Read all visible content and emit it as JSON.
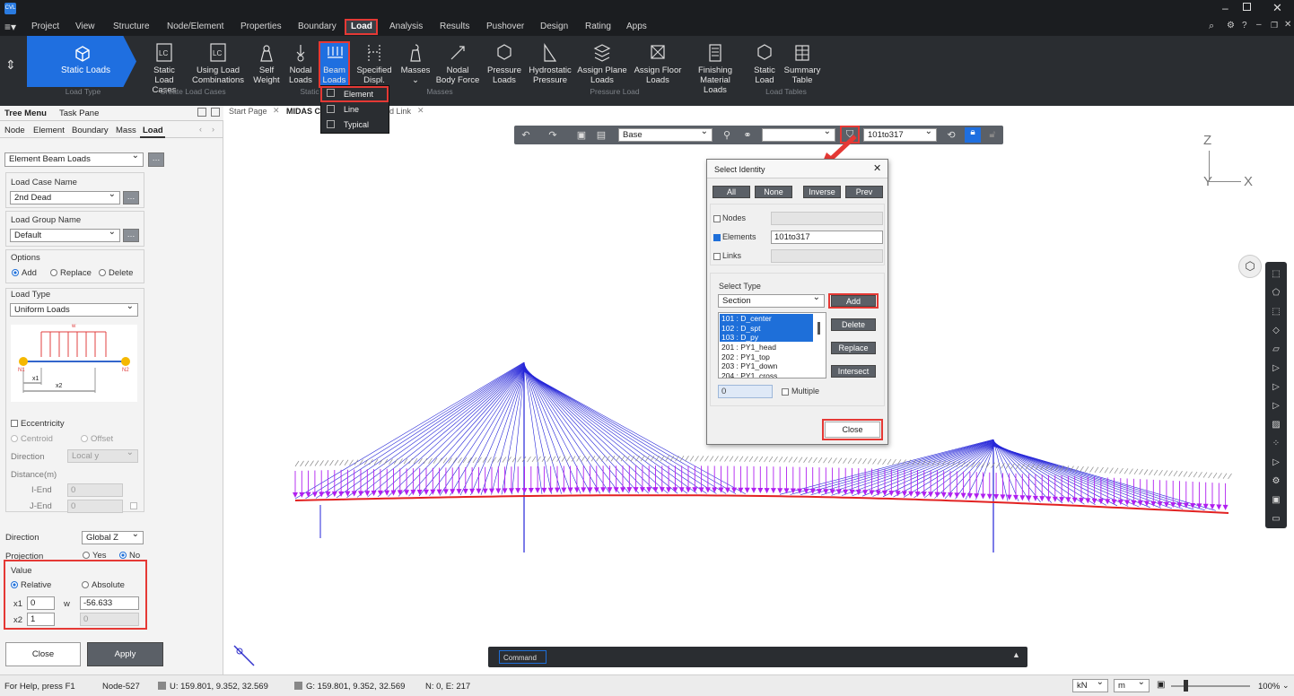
{
  "menu": [
    "Project",
    "View",
    "Structure",
    "Node/Element",
    "Properties",
    "Boundary",
    "Load",
    "Analysis",
    "Results",
    "Pushover",
    "Design",
    "Rating",
    "Apps"
  ],
  "ribbon": {
    "static_loads": "Static Loads",
    "load_type_group": "Load Type",
    "lc_cases": [
      "Static Load",
      "Cases"
    ],
    "using_combos": [
      "Using Load",
      "Combinations"
    ],
    "create_group": "Create Load Cases",
    "self_weight": [
      "Self",
      "Weight"
    ],
    "nodal_loads": [
      "Nodal",
      "Loads"
    ],
    "beam_loads": [
      "Beam",
      "Loads"
    ],
    "spec_displ": [
      "Specified",
      "Displ."
    ],
    "static_group": "Static",
    "masses": "Masses",
    "nodal_body": [
      "Nodal",
      "Body Force"
    ],
    "masses_group": "Masses",
    "pressure_loads": [
      "Pressure",
      "Loads"
    ],
    "hydrostatic": [
      "Hydrostatic",
      "Pressure"
    ],
    "assign_plane": [
      "Assign Plane",
      "Loads"
    ],
    "assign_floor": [
      "Assign Floor",
      "Loads"
    ],
    "pressure_group": "Pressure Load",
    "finishing": [
      "Finishing",
      "Material Loads"
    ],
    "static_load": [
      "Static",
      "Load"
    ],
    "summary_table": [
      "Summary",
      "Table"
    ],
    "tables_group": "Load Tables"
  },
  "dropdown": {
    "items": [
      "Element",
      "Line",
      "Typical"
    ]
  },
  "tabs": {
    "tree_menu": "Tree Menu",
    "task_pane": "Task Pane",
    "start_page": "Start Page",
    "midas": "MIDAS C",
    "link_tab": "d Link"
  },
  "subtabs": [
    "Node",
    "Element",
    "Boundary",
    "Mass",
    "Load"
  ],
  "panel": {
    "type_select": "Element Beam Loads",
    "load_case_label": "Load Case Name",
    "load_case": "2nd Dead",
    "load_group_label": "Load Group Name",
    "load_group": "Default",
    "options_label": "Options",
    "opt_add": "Add",
    "opt_replace": "Replace",
    "opt_delete": "Delete",
    "load_type_label": "Load Type",
    "load_type": "Uniform Loads",
    "eccentricity": "Eccentricity",
    "centroid": "Centroid",
    "offset": "Offset",
    "direction_label": "Direction",
    "direction_ecc": "Local y",
    "distance_label": "Distance(m)",
    "iend": "I-End",
    "jend": "J-End",
    "iend_val": "0",
    "jend_val": "0",
    "direction2_label": "Direction",
    "direction2": "Global Z",
    "projection_label": "Projection",
    "proj_yes": "Yes",
    "proj_no": "No",
    "value_label": "Value",
    "relative": "Relative",
    "absolute": "Absolute",
    "x1_label": "x1",
    "x1": "0",
    "w_label": "w",
    "w": "-56.633",
    "x2_label": "x2",
    "x2": "1",
    "x2_w": "0",
    "close": "Close",
    "apply": "Apply",
    "diagram": {
      "w": "w",
      "n1": "N1",
      "n2": "N2",
      "x1": "x1",
      "x2": "x2"
    }
  },
  "toolbar": {
    "base": "Base",
    "blank": "",
    "range": "101to317"
  },
  "dialog": {
    "title": "Select Identity",
    "all": "All",
    "none": "None",
    "inverse": "Inverse",
    "prev": "Prev",
    "nodes": "Nodes",
    "elements": "Elements",
    "elements_val": "101to317",
    "links": "Links",
    "select_type": "Select Type",
    "section": "Section",
    "add": "Add",
    "delete": "Delete",
    "replace": "Replace",
    "intersect": "Intersect",
    "list": [
      "101 : D_center",
      "102 : D_spt",
      "103 : D_py",
      "201 : PY1_head",
      "202 : PY1_top",
      "203 : PY1_down",
      "204 : PY1_cross"
    ],
    "num": "0",
    "multiple": "Multiple",
    "close": "Close"
  },
  "axes": {
    "z": "Z",
    "y": "Y",
    "x": "X"
  },
  "command": "Command",
  "status": {
    "help": "For Help, press F1",
    "node": "Node-527",
    "u": "U: 159.801, 9.352, 32.569",
    "g": "G: 159.801, 9.352, 32.569",
    "ne": "N: 0, E: 217",
    "unit_force": "kN",
    "unit_len": "m",
    "zoom": "100%"
  },
  "colors": {
    "accent": "#1e6fd9",
    "ribbon_active": "#1f6fe0",
    "highlight": "#e53935",
    "cable": "#2525d8",
    "deck": "#e22222",
    "load": "#b020f0"
  }
}
